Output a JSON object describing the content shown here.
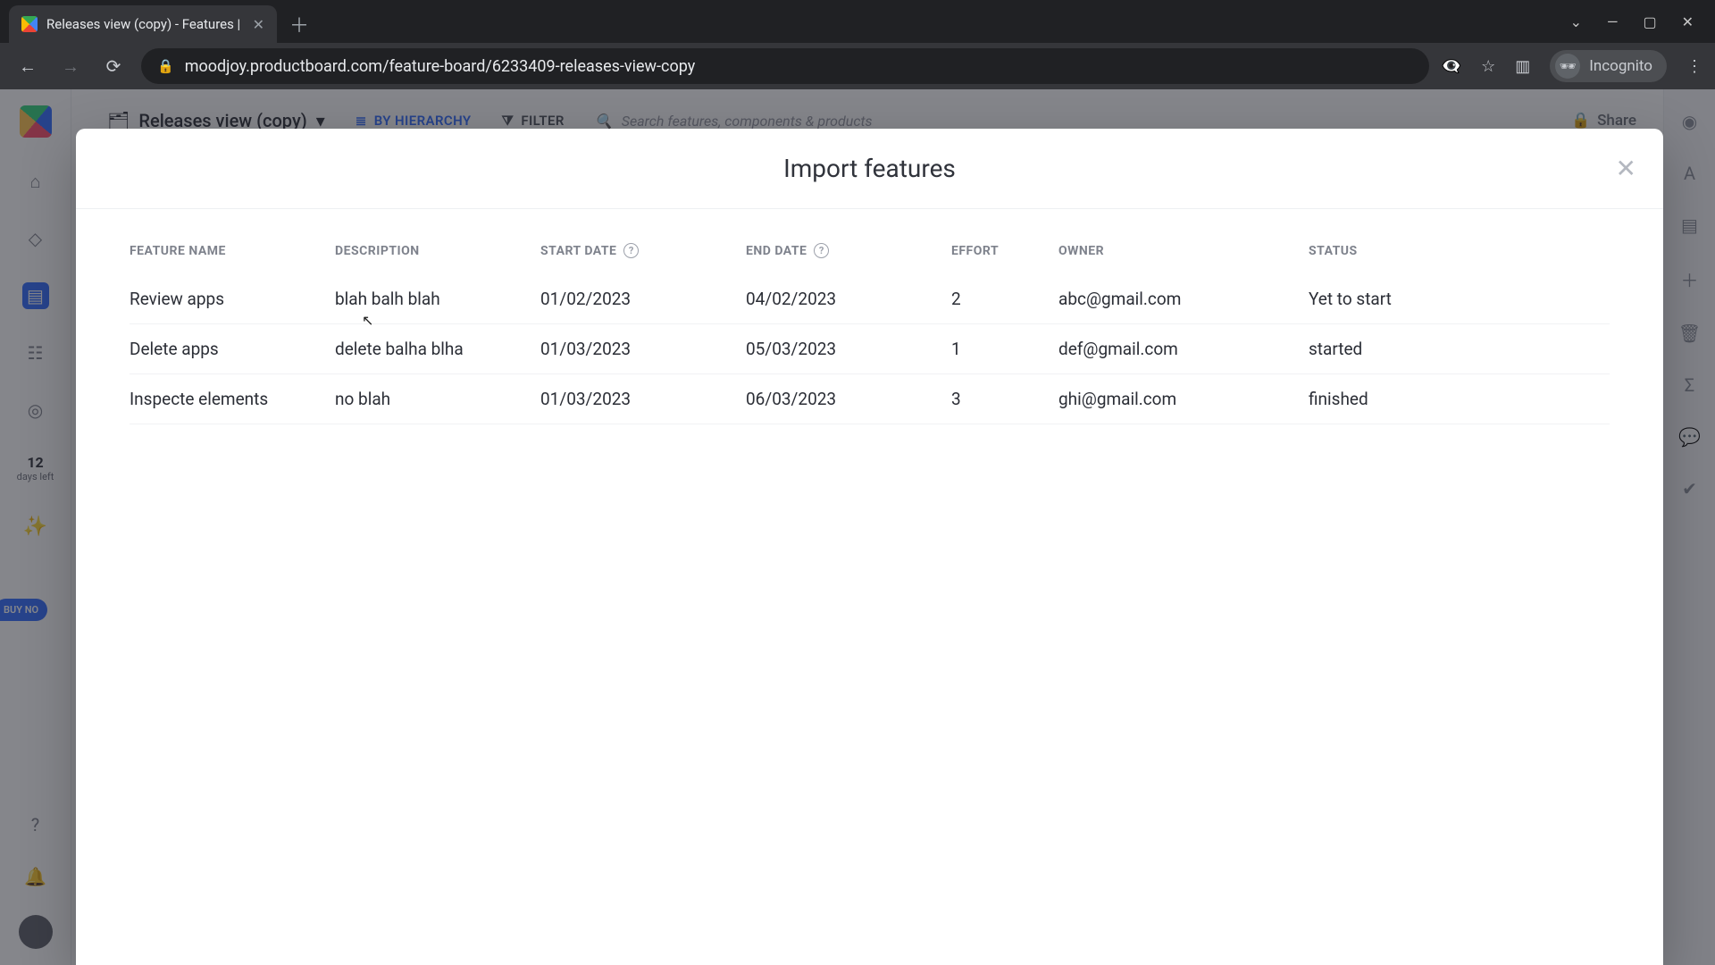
{
  "browser": {
    "tab_title": "Releases view (copy) - Features |",
    "url": "moodjoy.productboard.com/feature-board/6233409-releases-view-copy",
    "incognito_label": "Incognito"
  },
  "board": {
    "title": "Releases view (copy)",
    "hierarchy_label": "BY HIERARCHY",
    "filter_label": "FILTER",
    "search_placeholder": "Search features, components & products",
    "share_label": "Share",
    "trial_days": "12",
    "trial_sub": "days left",
    "buy_label": "BUY NO"
  },
  "modal": {
    "title": "Import features",
    "columns": {
      "name": "FEATURE NAME",
      "desc": "DESCRIPTION",
      "start": "START DATE",
      "end": "END DATE",
      "effort": "EFFORT",
      "owner": "OWNER",
      "status": "STATUS"
    },
    "rows": [
      {
        "name": "Review apps",
        "desc": "blah balh blah",
        "start": "01/02/2023",
        "end": "04/02/2023",
        "effort": "2",
        "owner": "abc@gmail.com",
        "status": "Yet to start"
      },
      {
        "name": "Delete apps",
        "desc": "delete balha blha",
        "start": "01/03/2023",
        "end": "05/03/2023",
        "effort": "1",
        "owner": "def@gmail.com",
        "status": "started"
      },
      {
        "name": "Inspecte elements",
        "desc": "no blah",
        "start": "01/03/2023",
        "end": "06/03/2023",
        "effort": "3",
        "owner": "ghi@gmail.com",
        "status": "finished"
      }
    ]
  }
}
